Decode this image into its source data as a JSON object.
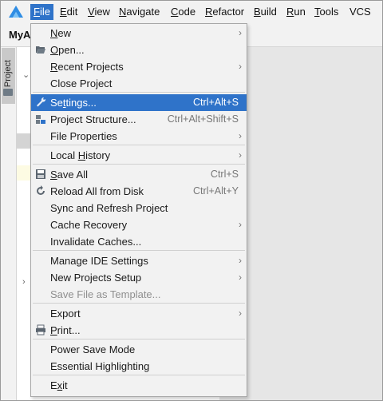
{
  "menubar": {
    "items": [
      {
        "label": "File",
        "mnemonic": "F",
        "rest": "ile",
        "active": true
      },
      {
        "label": "Edit",
        "mnemonic": "E",
        "rest": "dit"
      },
      {
        "label": "View",
        "mnemonic": "V",
        "rest": "iew"
      },
      {
        "label": "Navigate",
        "mnemonic": "N",
        "rest": "avigate"
      },
      {
        "label": "Code",
        "mnemonic": "C",
        "rest": "ode"
      },
      {
        "label": "Refactor",
        "mnemonic": "R",
        "rest": "efactor"
      },
      {
        "label": "Build",
        "mnemonic": "B",
        "rest": "uild"
      },
      {
        "label": "Run",
        "mnemonic": "R",
        "rest": "un"
      },
      {
        "label": "Tools",
        "mnemonic": "T",
        "rest": "ools"
      },
      {
        "label": "VCS",
        "mnemonic": "",
        "rest": "VCS"
      }
    ],
    "logo_icon": "deveco-logo-icon"
  },
  "toolbar": {
    "project_name": "MyA"
  },
  "side": {
    "project_tab_label": "Project"
  },
  "file_menu": {
    "items": [
      {
        "pre": "",
        "u": "N",
        "post": "ew",
        "shortcut": "",
        "submenu": true,
        "icon": ""
      },
      {
        "pre": "",
        "u": "O",
        "post": "pen...",
        "shortcut": "",
        "submenu": false,
        "icon": "folder-open-icon"
      },
      {
        "pre": "",
        "u": "R",
        "post": "ecent Projects",
        "shortcut": "",
        "submenu": true,
        "icon": ""
      },
      {
        "pre": "Close Pro",
        "u": "",
        "post": "ject",
        "shortcut": "",
        "submenu": false,
        "icon": ""
      },
      {
        "pre": "Se",
        "u": "t",
        "post": "tings...",
        "shortcut": "Ctrl+Alt+S",
        "submenu": false,
        "icon": "wrench-icon",
        "selected": true
      },
      {
        "pre": "Project Structure...",
        "u": "",
        "post": "",
        "shortcut": "Ctrl+Alt+Shift+S",
        "submenu": false,
        "icon": "project-structure-icon"
      },
      {
        "pre": "File Properties",
        "u": "",
        "post": "",
        "shortcut": "",
        "submenu": true,
        "icon": ""
      },
      {
        "pre": "Local ",
        "u": "H",
        "post": "istory",
        "shortcut": "",
        "submenu": true,
        "icon": ""
      },
      {
        "pre": "",
        "u": "S",
        "post": "ave All",
        "shortcut": "Ctrl+S",
        "submenu": false,
        "icon": "save-icon"
      },
      {
        "pre": "Reload All from Disk",
        "u": "",
        "post": "",
        "shortcut": "Ctrl+Alt+Y",
        "submenu": false,
        "icon": "reload-icon"
      },
      {
        "pre": "Sync and Refresh Project",
        "u": "",
        "post": "",
        "shortcut": "",
        "submenu": false,
        "icon": ""
      },
      {
        "pre": "Cache Recovery",
        "u": "",
        "post": "",
        "shortcut": "",
        "submenu": true,
        "icon": ""
      },
      {
        "pre": "Invalidate Caches...",
        "u": "",
        "post": "",
        "shortcut": "",
        "submenu": false,
        "icon": ""
      },
      {
        "pre": "Manage IDE Settings",
        "u": "",
        "post": "",
        "shortcut": "",
        "submenu": true,
        "icon": ""
      },
      {
        "pre": "New Projects Setup",
        "u": "",
        "post": "",
        "shortcut": "",
        "submenu": true,
        "icon": ""
      },
      {
        "pre": "Save File as Template...",
        "u": "",
        "post": "",
        "shortcut": "",
        "submenu": false,
        "icon": "",
        "disabled": true
      },
      {
        "pre": "Export",
        "u": "",
        "post": "",
        "shortcut": "",
        "submenu": true,
        "icon": ""
      },
      {
        "pre": "",
        "u": "P",
        "post": "rint...",
        "shortcut": "",
        "submenu": false,
        "icon": "print-icon"
      },
      {
        "pre": "Power Save Mode",
        "u": "",
        "post": "",
        "shortcut": "",
        "submenu": false,
        "icon": ""
      },
      {
        "pre": "Essential Highlighting",
        "u": "",
        "post": "",
        "shortcut": "",
        "submenu": false,
        "icon": ""
      },
      {
        "pre": "E",
        "u": "x",
        "post": "it",
        "shortcut": "",
        "submenu": false,
        "icon": ""
      }
    ]
  },
  "colors": {
    "accent": "#2f73c9",
    "menu_bg": "#f2f2f2",
    "editor_bg": "#e6e6e6"
  }
}
